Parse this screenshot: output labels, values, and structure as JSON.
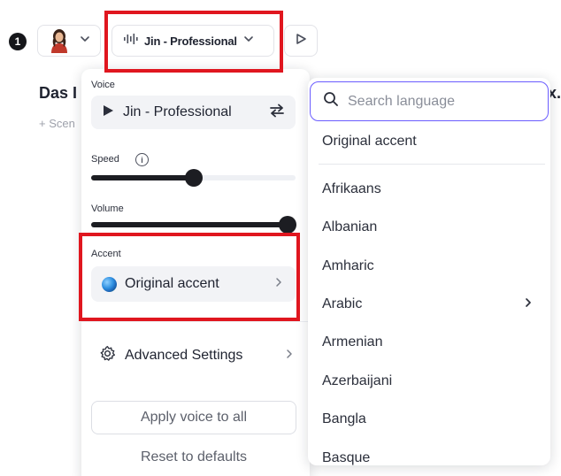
{
  "scene": {
    "number": "1",
    "title_start": "Das I",
    "title_end": "x.",
    "add_scene": "+ Scen"
  },
  "toolbar": {
    "voice_label": "Jin - Professional"
  },
  "voice_panel": {
    "voice_label": "Voice",
    "voice_name": "Jin - Professional",
    "speed_label": "Speed",
    "speed_value": 0.5,
    "volume_label": "Volume",
    "volume_value": 1.0,
    "accent_label": "Accent",
    "accent_value": "Original accent",
    "advanced_label": "Advanced Settings",
    "apply_label": "Apply voice to all",
    "reset_label": "Reset to defaults"
  },
  "language_menu": {
    "search_placeholder": "Search language",
    "original": "Original accent",
    "languages": [
      "Afrikaans",
      "Albanian",
      "Amharic",
      "Arabic",
      "Armenian",
      "Azerbaijani",
      "Bangla",
      "Basque"
    ]
  },
  "colors": {
    "highlight": "#e0161f",
    "focus": "#6a5cff",
    "slider": "#1c1d22"
  }
}
